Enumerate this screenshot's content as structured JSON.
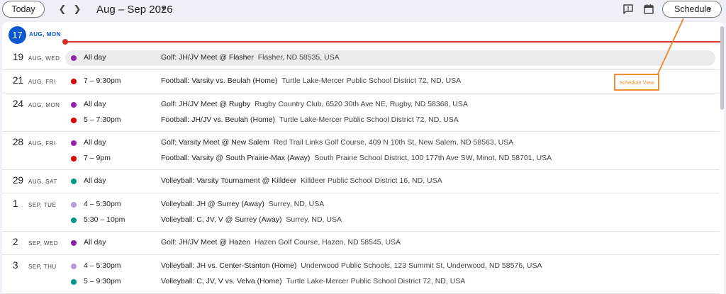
{
  "toolbar": {
    "today_label": "Today",
    "prev_icon": "chevron-left-icon",
    "next_icon": "chevron-right-icon",
    "date_range": "Aug – Sep 2026",
    "feedback_icon": "feedback-icon",
    "calendar_icon": "calendar-icon",
    "view_label": "Schedule"
  },
  "today": {
    "num": "17",
    "label": "AUG, MON"
  },
  "annotation": {
    "label": "Schedule View",
    "color": "#f08b34"
  },
  "colors": {
    "golf": "#8e24aa",
    "football": "#d50000",
    "volleyball": "#009688",
    "volleyball_jh": "#b39ddb",
    "today_accent": "#0b57d0",
    "now_line": "#d93025"
  },
  "days": [
    {
      "num": "19",
      "label": "AUG, WED",
      "events": [
        {
          "time": "All day",
          "title": "Golf: JH/JV Meet @ Flasher",
          "location": "Flasher, ND 58535, USA",
          "dot": "#8e24aa"
        }
      ]
    },
    {
      "num": "21",
      "label": "AUG, FRI",
      "events": [
        {
          "time": "7 – 9:30pm",
          "title": "Football: Varsity vs. Beulah (Home)",
          "location": "Turtle Lake-Mercer Public School District 72, ND, USA",
          "dot": "#d50000"
        }
      ]
    },
    {
      "num": "24",
      "label": "AUG, MON",
      "events": [
        {
          "time": "All day",
          "title": "Golf: JH/JV Meet @ Rugby",
          "location": "Rugby Country Club, 6520 30th Ave NE, Rugby, ND 58368, USA",
          "dot": "#8e24aa"
        },
        {
          "time": "5 – 7:30pm",
          "title": "Football: JH/JV vs. Beulah (Home)",
          "location": "Turtle Lake-Mercer Public School District 72, ND, USA",
          "dot": "#d50000"
        }
      ]
    },
    {
      "num": "28",
      "label": "AUG, FRI",
      "events": [
        {
          "time": "All day",
          "title": "Golf: Varsity Meet @ New Salem",
          "location": "Red Trail Links Golf Course, 409 N 10th St, New Salem, ND 58563, USA",
          "dot": "#8e24aa"
        },
        {
          "time": "7 – 9pm",
          "title": "Football: Varsity @ South Prairie-Max (Away)",
          "location": "South Prairie School District, 100 177th Ave SW, Minot, ND 58701, USA",
          "dot": "#d50000"
        }
      ]
    },
    {
      "num": "29",
      "label": "AUG, SAT",
      "events": [
        {
          "time": "All day",
          "title": "Volleyball: Varsity Tournament @ Killdeer",
          "location": "Killdeer Public School District 16, ND, USA",
          "dot": "#009688"
        }
      ]
    },
    {
      "num": "1",
      "label": "SEP, TUE",
      "events": [
        {
          "time": "4 – 5:30pm",
          "title": "Volleyball: JH @ Surrey (Away)",
          "location": "Surrey, ND, USA",
          "dot": "#b39ddb"
        },
        {
          "time": "5:30 – 10pm",
          "title": "Volleyball: C, JV, V @ Surrey (Away)",
          "location": "Surrey, ND, USA",
          "dot": "#009688"
        }
      ]
    },
    {
      "num": "2",
      "label": "SEP, WED",
      "events": [
        {
          "time": "All day",
          "title": "Golf: JH/JV Meet @ Hazen",
          "location": "Hazen Golf Course, Hazen, ND 58545, USA",
          "dot": "#8e24aa"
        }
      ]
    },
    {
      "num": "3",
      "label": "SEP, THU",
      "events": [
        {
          "time": "4 – 5:30pm",
          "title": "Volleyball: JH vs. Center-Stanton (Home)",
          "location": "Underwood Public Schools, 123 Summit St, Underwood, ND 58576, USA",
          "dot": "#b39ddb"
        },
        {
          "time": "5 – 9:30pm",
          "title": "Volleyball: C, JV, V vs. Velva (Home)",
          "location": "Turtle Lake-Mercer Public School District 72, ND, USA",
          "dot": "#009688"
        }
      ]
    }
  ]
}
